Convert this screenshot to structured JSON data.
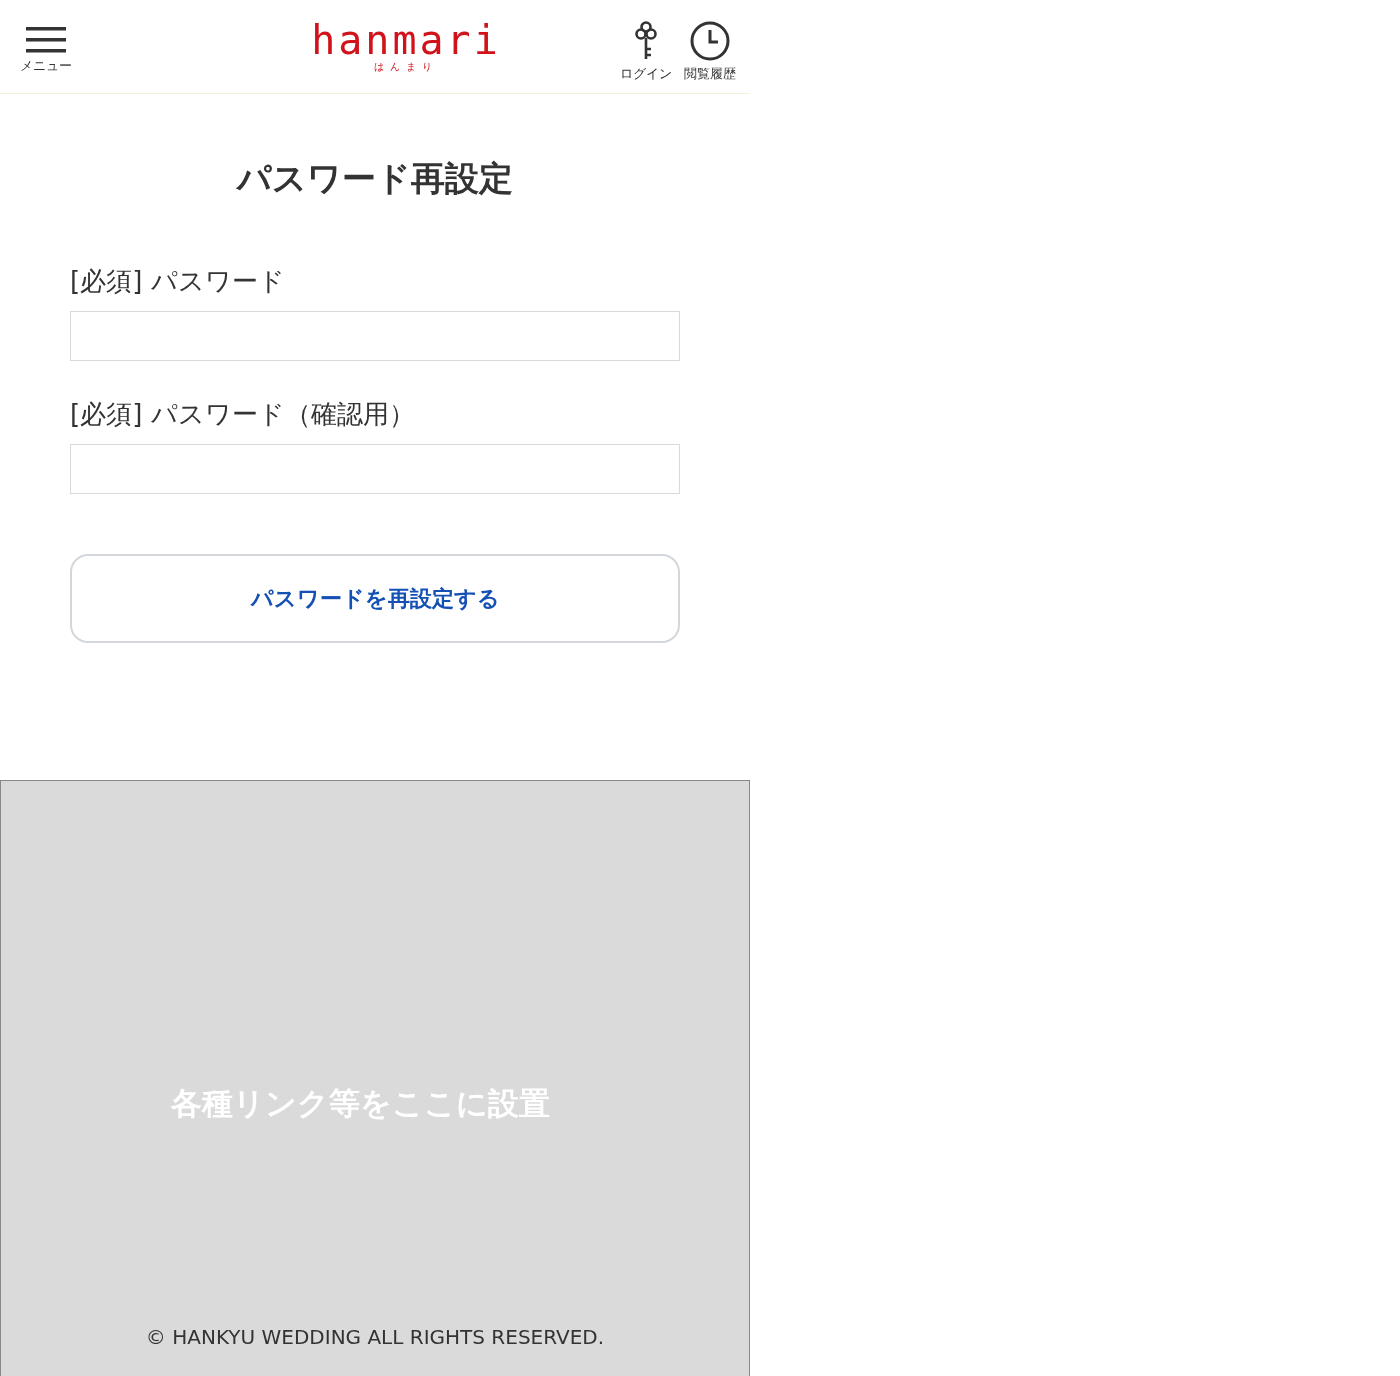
{
  "header": {
    "menu_label": "メニュー",
    "logo": "hanmari",
    "logo_kana": "はんまり",
    "login_label": "ログイン",
    "history_label": "閲覧履歴"
  },
  "title": "パスワード再設定",
  "fields": [
    {
      "label": "[必須] パスワード"
    },
    {
      "label": "[必須] パスワード（確認用）"
    }
  ],
  "submit": "パスワードを再設定する",
  "footer": {
    "links_placeholder": "各種リンク等をここに設置",
    "copyright": "© HANKYU WEDDING ALL RIGHTS RESERVED."
  }
}
